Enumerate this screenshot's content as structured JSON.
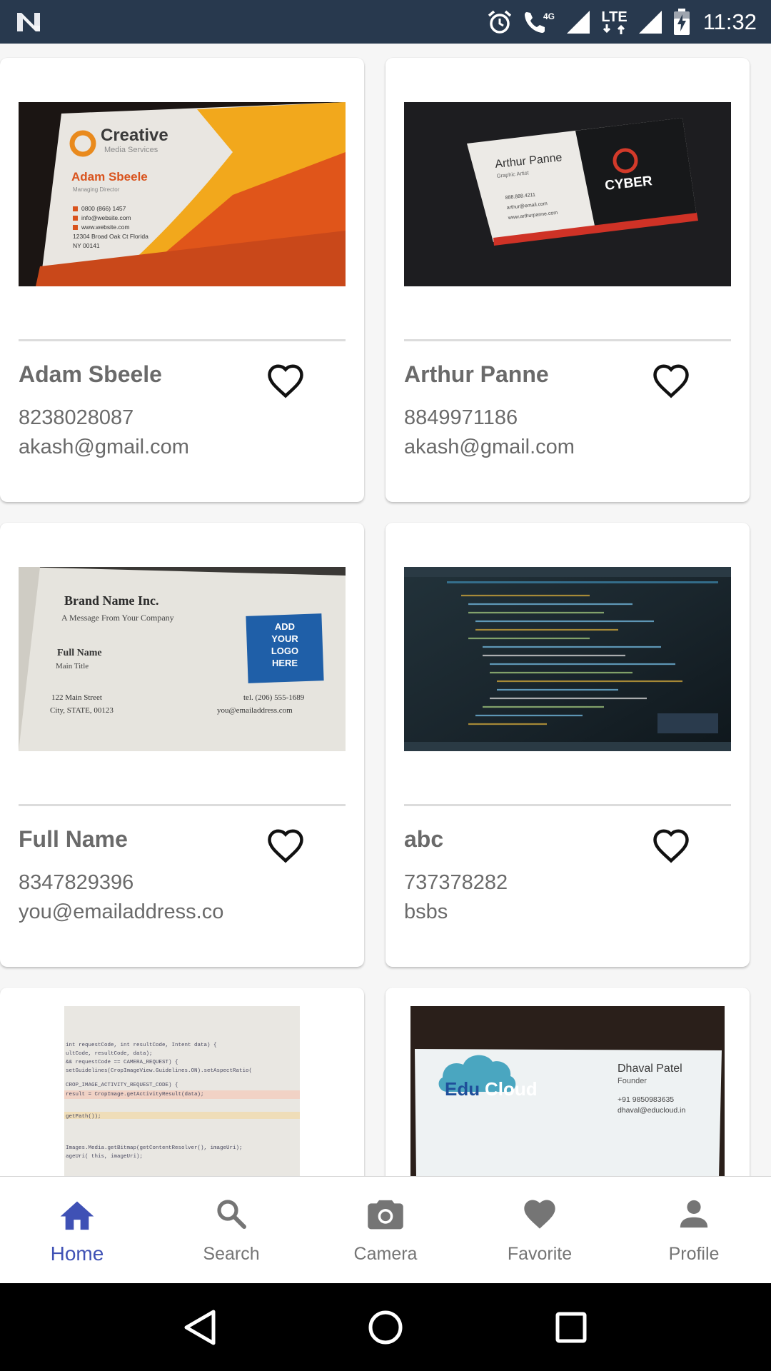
{
  "status_bar": {
    "time": "11:32",
    "network_label": "4G",
    "lte_label": "LTE"
  },
  "cards": [
    {
      "name": "Adam Sbeele",
      "phone": "8238028087",
      "email": "akash@gmail.com",
      "favorite": false,
      "image": {
        "brand": "Creative",
        "brand_sub": "Media Services",
        "person": "Adam Sbeele",
        "title": "Managing Director",
        "lines": [
          "0800 (866) 1457",
          "info@website.com",
          "www.website.com",
          "12304 Broad Oak Ct Florida",
          "NY 00141"
        ]
      }
    },
    {
      "name": "Arthur Panne",
      "phone": "8849971186",
      "email": "akash@gmail.com",
      "favorite": false,
      "image": {
        "person": "Arthur Panne",
        "title": "Graphic Artist",
        "brand": "CYBER",
        "lines": [
          "888.888.4211",
          "arthur@email.com",
          "www.arthurpanne.com"
        ]
      }
    },
    {
      "name": "Full Name",
      "phone": "8347829396",
      "email": "you@emailaddress.co",
      "favorite": false,
      "image": {
        "brand": "Brand Name Inc.",
        "tagline": "A Message From Your Company",
        "person": "Full Name",
        "title": "Main Title",
        "logo_text": "ADD YOUR LOGO HERE",
        "address1": "122 Main Street",
        "address2": "City, STATE, 00123",
        "tel": "tel. (206) 555-1689",
        "email": "you@emailaddress.com"
      }
    },
    {
      "name": "abc",
      "phone": "737378282",
      "email": "bsbs",
      "favorite": false,
      "image": {
        "kind": "code-screen-photo"
      }
    },
    {
      "image": {
        "kind": "code-printout-photo",
        "lines": [
          "int requestCode, int resultCode, Intent data) {",
          "ultCode, resultCode, data);",
          "&& requestCode == CAMERA_REQUEST) {",
          "setGuidelines(CropImageView.Guidelines.ON).setAspectRatio(",
          "CROP_IMAGE_ACTIVITY_REQUEST_CODE) {",
          "result = CropImage.getActivityResult(data);",
          "getPath());",
          "Images.Media.getBitmap(getContentResolver(), imageUri);",
          "ageUri( this, imageUri);"
        ]
      }
    },
    {
      "image": {
        "brand_a": "Edu",
        "brand_b": "Cloud",
        "person": "Dhaval Patel",
        "title": "Founder",
        "phone": "+91 9850983635",
        "email": "dhaval@educloud.in"
      }
    }
  ],
  "bottom_nav": {
    "items": [
      {
        "label": "Home",
        "icon": "home-icon",
        "active": true
      },
      {
        "label": "Search",
        "icon": "search-icon",
        "active": false
      },
      {
        "label": "Camera",
        "icon": "camera-icon",
        "active": false
      },
      {
        "label": "Favorite",
        "icon": "heart-icon",
        "active": false
      },
      {
        "label": "Profile",
        "icon": "person-icon",
        "active": false
      }
    ]
  },
  "colors": {
    "status_bar": "#28394e",
    "accent": "#3f51b5",
    "text_secondary": "#6a6a6a",
    "nav_inactive": "#757575"
  }
}
